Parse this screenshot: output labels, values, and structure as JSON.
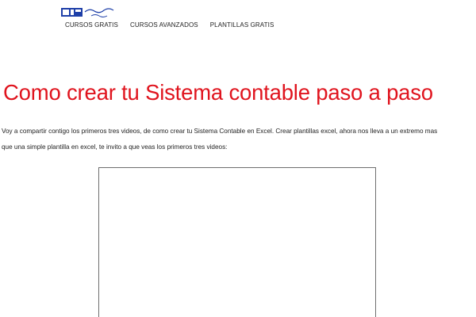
{
  "header": {
    "logo_icon": "site-logo",
    "nav": [
      {
        "label": "CURSOS GRATIS"
      },
      {
        "label": "CURSOS AVANZADOS"
      },
      {
        "label": "PLANTILLAS GRATIS"
      }
    ]
  },
  "article": {
    "title": "Como crear tu Sistema contable paso a paso",
    "intro_line1": "Voy a compartir contigo los primeros tres videos, de como crear tu Sistema Contable en Excel. Crear plantillas excel, ahora nos lleva a un extremo mas",
    "intro_line2": "que una simple plantilla en excel, te invito a que veas los primeros tres videos:"
  },
  "colors": {
    "title": "#e0141e",
    "text": "#222222",
    "logo_blue": "#1e3fa8"
  }
}
